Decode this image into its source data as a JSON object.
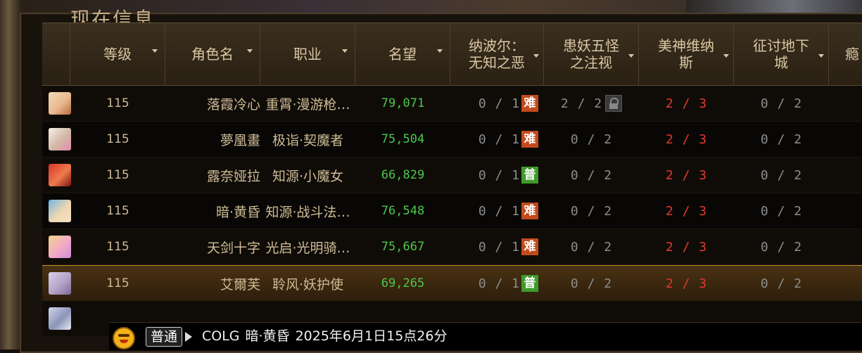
{
  "window": {
    "title": "现在信息"
  },
  "columns": [
    {
      "key": "avatar",
      "label": ""
    },
    {
      "key": "level",
      "label": "等级"
    },
    {
      "key": "name",
      "label": "角色名"
    },
    {
      "key": "job",
      "label": "职业"
    },
    {
      "key": "fame",
      "label": "名望"
    },
    {
      "key": "raid1",
      "label_line1": "纳波尔：",
      "label_line2": "无知之恶"
    },
    {
      "key": "raid2",
      "label_line1": "患妖五怪",
      "label_line2": "之注视"
    },
    {
      "key": "raid3",
      "label_line1": "美神维纳",
      "label_line2": "斯"
    },
    {
      "key": "raid4",
      "label_line1": "征讨地下",
      "label_line2": "城"
    },
    {
      "key": "raid5",
      "label": "瘾"
    }
  ],
  "rows": [
    {
      "avatar_icon": "avatar-blonde-girl-icon",
      "level": "115",
      "name": "落霞冷心",
      "job": "重霄·漫游枪…",
      "fame": "79,071",
      "raid1": "0 / 1",
      "raid1_badge": "难",
      "raid1_badge_type": "hard",
      "raid2": "2 / 2",
      "raid2_locked": true,
      "raid3": "2 / 3",
      "raid4": "0 / 2"
    },
    {
      "avatar_icon": "avatar-white-hair-icon",
      "level": "115",
      "name": "夢凰畫",
      "job": "极诣·契魔者",
      "fame": "75,504",
      "raid1": "0 / 1",
      "raid1_badge": "难",
      "raid1_badge_type": "hard",
      "raid2": "0 / 2",
      "raid2_locked": false,
      "raid3": "2 / 3",
      "raid4": "0 / 2"
    },
    {
      "avatar_icon": "avatar-red-hair-icon",
      "level": "115",
      "name": "露奈娅拉",
      "job": "知源·小魔女",
      "fame": "66,829",
      "raid1": "0 / 1",
      "raid1_badge": "普",
      "raid1_badge_type": "normal",
      "raid2": "0 / 2",
      "raid2_locked": false,
      "raid3": "2 / 3",
      "raid4": "0 / 2"
    },
    {
      "avatar_icon": "avatar-blue-blonde-icon",
      "level": "115",
      "name": "暗·黄昏",
      "job": "知源·战斗法…",
      "fame": "76,548",
      "raid1": "0 / 1",
      "raid1_badge": "难",
      "raid1_badge_type": "hard",
      "raid2": "0 / 2",
      "raid2_locked": false,
      "raid3": "2 / 3",
      "raid4": "0 / 2"
    },
    {
      "avatar_icon": "avatar-pink-blonde-icon",
      "level": "115",
      "name": "天剑十字",
      "job": "光启·光明骑…",
      "fame": "75,667",
      "raid1": "0 / 1",
      "raid1_badge": "难",
      "raid1_badge_type": "hard",
      "raid2": "0 / 2",
      "raid2_locked": false,
      "raid3": "2 / 3",
      "raid4": "0 / 2"
    },
    {
      "avatar_icon": "avatar-silver-hair-icon",
      "level": "115",
      "name": "艾爾芙",
      "job": "聆风·妖护使",
      "fame": "69,265",
      "raid1": "0 / 1",
      "raid1_badge": "普",
      "raid1_badge_type": "normal",
      "raid2": "0 / 2",
      "raid2_locked": false,
      "raid3": "2 / 3",
      "raid4": "0 / 2",
      "selected": true
    },
    {
      "avatar_icon": "avatar-partial-icon",
      "level": "",
      "name": "",
      "job": "",
      "fame": "",
      "raid1": "",
      "raid1_badge": "",
      "raid1_badge_type": "normal",
      "raid2": "",
      "raid2_locked": false,
      "raid3": "",
      "raid4": ""
    }
  ],
  "chat": {
    "emote_icon": "smiley-emote-icon",
    "channel": "普通",
    "arrow_icon": "play-arrow-icon",
    "sender_prefix": "COLG",
    "sender_name": "暗·黄昏",
    "message": "2025年6月1日15点26分"
  },
  "colors": {
    "header_text": "#d9c8a4",
    "body_text": "#cdbb95",
    "fame": "#4cc74c",
    "progress_red": "#e03a2f",
    "badge_hard": "#c34a1b",
    "badge_normal": "#3f9b2c",
    "selected_border": "#c2842a"
  }
}
